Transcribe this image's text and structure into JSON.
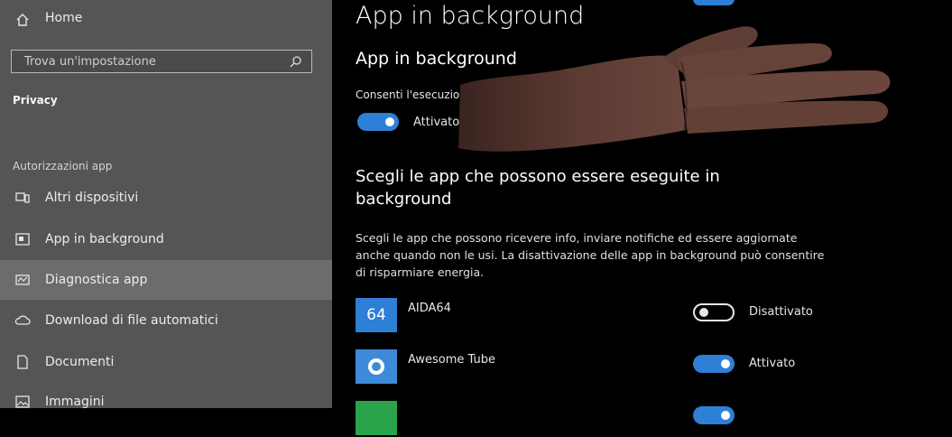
{
  "sidebar": {
    "home_label": "Home",
    "search_placeholder": "Trova un'impostazione",
    "section_title": "Privacy",
    "group_title": "Autorizzazioni app",
    "items": [
      {
        "label": "Altri dispositivi",
        "icon": "devices-icon"
      },
      {
        "label": "App in background",
        "icon": "background-apps-icon"
      },
      {
        "label": "Diagnostica app",
        "icon": "diagnostics-icon"
      },
      {
        "label": "Download di file automatici",
        "icon": "cloud-icon"
      },
      {
        "label": "Documenti",
        "icon": "document-icon"
      },
      {
        "label": "Immagini",
        "icon": "image-icon"
      }
    ],
    "active_item": "Diagnostica app"
  },
  "main": {
    "page_title": "App in background",
    "sub_title": "App in background",
    "toggle_caption": "Consenti l'esecuzione",
    "master_toggle": {
      "on": true,
      "label": "Attivato"
    },
    "choose_title": "Scegli le app che possono essere eseguite in background",
    "description": "Scegli le app che possono ricevere info, inviare notifiche ed essere aggiornate anche quando non le usi. La disattivazione delle app in background può consentire di risparmiare energia.",
    "apps": [
      {
        "name": "AIDA64",
        "icon_text": "64",
        "icon_color": "#2e7fd6",
        "on": false,
        "state": "Disattivato"
      },
      {
        "name": "Awesome Tube",
        "icon_text": "◉",
        "icon_color": "#3d8ad8",
        "on": true,
        "state": "Attivato"
      },
      {
        "name": "",
        "icon_text": "",
        "icon_color": "#2aa34a",
        "on": true,
        "state": ""
      }
    ]
  },
  "colors": {
    "sidebar_bg": "#555558",
    "active_item_bg": "#6c6c6f",
    "accent": "#2e7fd6",
    "main_bg": "#000000"
  }
}
